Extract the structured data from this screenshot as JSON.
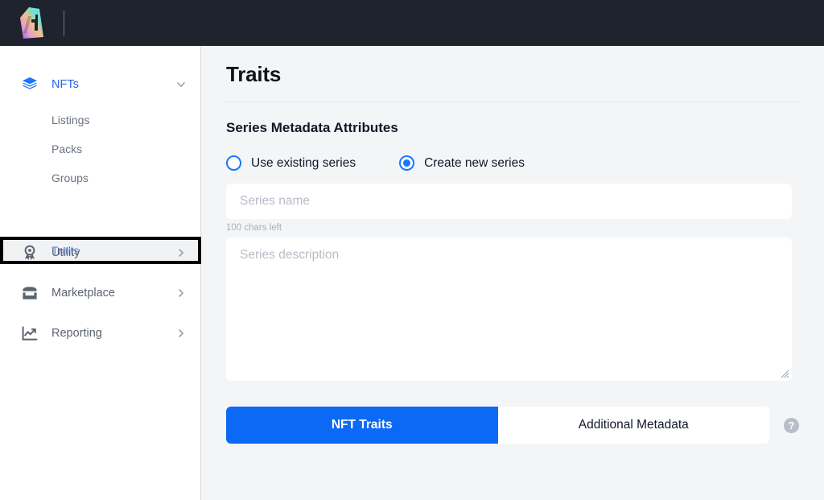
{
  "topbar": {
    "logo_name": "brand-logo",
    "divider": true
  },
  "sidebar": {
    "groups": [
      {
        "label": "NFTs",
        "icon": "layers-icon",
        "chevron": "chevron-down-icon",
        "expanded": true,
        "active": true,
        "items": [
          {
            "label": "Listings",
            "selected": false
          },
          {
            "label": "Packs",
            "selected": false
          },
          {
            "label": "Groups",
            "selected": false
          },
          {
            "label": "Traits",
            "selected": true
          }
        ]
      },
      {
        "label": "Utility",
        "icon": "award-ribbon-icon",
        "chevron": "chevron-right-icon",
        "expanded": false,
        "active": false,
        "items": []
      },
      {
        "label": "Marketplace",
        "icon": "storefront-icon",
        "chevron": "chevron-right-icon",
        "expanded": false,
        "active": false,
        "items": []
      },
      {
        "label": "Reporting",
        "icon": "chart-trending-icon",
        "chevron": "chevron-right-icon",
        "expanded": false,
        "active": false,
        "items": []
      }
    ]
  },
  "main": {
    "page_title": "Traits",
    "section_title": "Series Metadata Attributes",
    "series_mode": {
      "options": [
        {
          "label": "Use existing series",
          "selected": false
        },
        {
          "label": "Create new series",
          "selected": true
        }
      ]
    },
    "series_name": {
      "value": "",
      "placeholder": "Series name",
      "chars_left": "100 chars left"
    },
    "series_description": {
      "value": "",
      "placeholder": "Series description"
    },
    "tabs": [
      {
        "label": "NFT Traits",
        "active": true
      },
      {
        "label": "Additional Metadata",
        "active": false
      }
    ],
    "help_icon_glyph": "?"
  },
  "colors": {
    "topbar_bg": "#1f232e",
    "accent_blue": "#0b69f5",
    "radio_blue": "#1677ff",
    "nav_active": "#2563eb",
    "page_bg": "#f4f5f7",
    "sidebar_bg": "#ffffff",
    "highlight_border": "#000000"
  }
}
